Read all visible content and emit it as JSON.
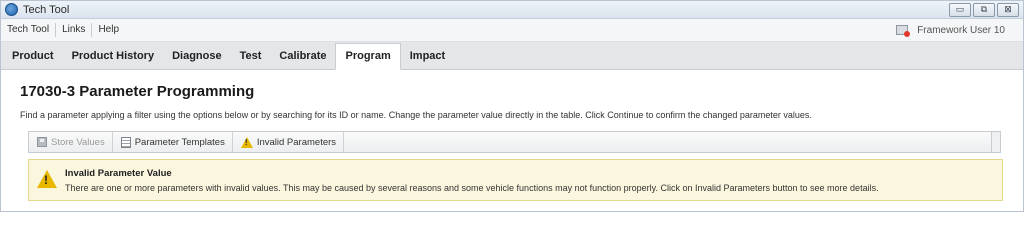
{
  "window": {
    "title": "Tech Tool",
    "controls": [
      "▭",
      "⧉",
      "⊠"
    ]
  },
  "menu": {
    "items": [
      "Tech Tool",
      "Links",
      "Help"
    ],
    "user": "Framework User 10"
  },
  "tabs": [
    {
      "label": "Product",
      "active": false
    },
    {
      "label": "Product History",
      "active": false
    },
    {
      "label": "Diagnose",
      "active": false
    },
    {
      "label": "Test",
      "active": false
    },
    {
      "label": "Calibrate",
      "active": false
    },
    {
      "label": "Program",
      "active": true
    },
    {
      "label": "Impact",
      "active": false
    }
  ],
  "page": {
    "title": "17030-3 Parameter Programming",
    "instructions": "Find a parameter applying a filter using the options below or by searching for its ID or name. Change the parameter value directly in the table. Click Continue to confirm the changed parameter values."
  },
  "toolbar": {
    "store_values": "Store Values",
    "parameter_templates": "Parameter Templates",
    "invalid_parameters": "Invalid Parameters"
  },
  "alert": {
    "title": "Invalid Parameter Value",
    "text": "There are one or more parameters with invalid values. This may be caused by several reasons and some vehicle functions may not function properly. Click on Invalid Parameters button to see more details."
  },
  "colors": {
    "alert_background": "#fbf7df",
    "warning_icon": "#e8b800",
    "active_tab": "#ffffff"
  }
}
